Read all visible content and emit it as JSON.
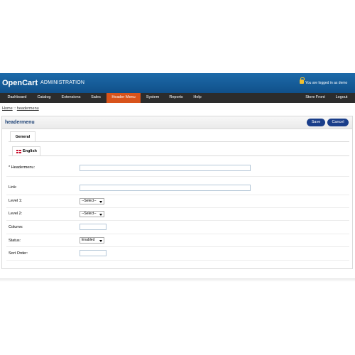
{
  "header": {
    "logo": "OpenCart",
    "separator": "|",
    "subtitle": "ADMINISTRATION",
    "logged_in": "You are logged in as demo"
  },
  "menu": {
    "items": [
      "Dashboard",
      "Catalog",
      "Extensions",
      "Sales",
      "Header Menu",
      "System",
      "Reports",
      "Help"
    ],
    "store_front": "Store Front",
    "logout": "Logout",
    "active_color": "#d8531b"
  },
  "breadcrumb": {
    "home": "Home",
    "separator": "::",
    "current": "headermenu"
  },
  "box": {
    "title": "headermenu",
    "save": "Save",
    "cancel": "Cancel"
  },
  "tabs": {
    "general": "General",
    "language": "English"
  },
  "form": {
    "headermenu_label": "* Headermenu:",
    "headermenu_value": "",
    "link_label": "Link:",
    "link_value": "",
    "level1_label": "Level 1:",
    "level1_value": "--Select--",
    "level2_label": "Level 2:",
    "level2_value": "--Select--",
    "column_label": "Column:",
    "column_value": "",
    "status_label": "Status:",
    "status_value": "Enabled",
    "sort_order_label": "Sort Order:",
    "sort_order_value": ""
  },
  "colors": {
    "header_blue": "#10508a",
    "menu_dark": "#2c2c2c",
    "button_blue": "#1a3e8a"
  }
}
